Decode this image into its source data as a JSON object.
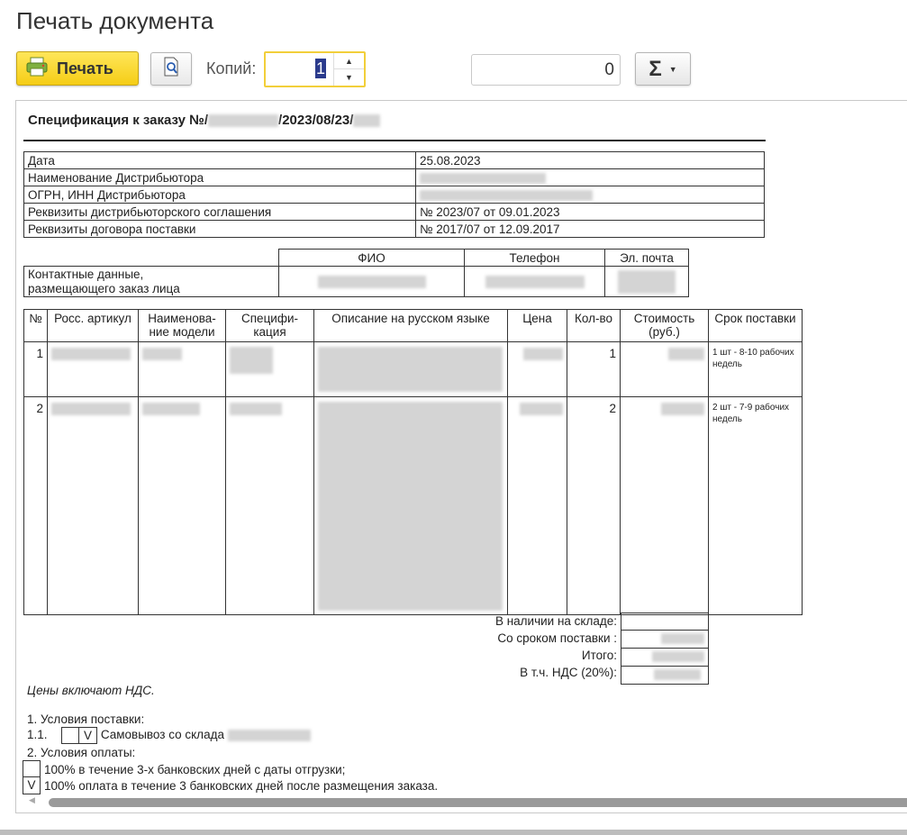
{
  "window": {
    "title": "Печать документа"
  },
  "toolbar": {
    "print_label": "Печать",
    "copies_label": "Копий:",
    "copies_value": "1",
    "sum_value": "0",
    "sum_symbol": "Σ"
  },
  "document": {
    "title_prefix": "Спецификация к заказу №/",
    "title_suffix": "/2023/08/23/",
    "info": [
      {
        "key": "Дата",
        "value": "25.08.2023"
      },
      {
        "key": "Наименование Дистрибьютора",
        "value": ""
      },
      {
        "key": "ОГРН, ИНН Дистрибьютора",
        "value": ""
      },
      {
        "key": "Реквизиты дистрибьюторского соглашения",
        "value": "№ 2023/07 от 09.01.2023"
      },
      {
        "key": "Реквизиты договора поставки",
        "value": "№ 2017/07 от 12.09.2017"
      }
    ],
    "contacts": {
      "headers": [
        "ФИО",
        "Телефон",
        "Эл. почта"
      ],
      "row_label_1": "Контактные данные,",
      "row_label_2": "размещающего заказ лица"
    },
    "items": {
      "headers": [
        "№",
        "Росс. артикул",
        "Наименова-ние модели",
        "Специфи-кация",
        "Описание на русском языке",
        "Цена",
        "Кол-во",
        "Стоимость (руб.)",
        "Срок поставки"
      ],
      "rows": [
        {
          "num": "1",
          "qty": "1",
          "delivery": "1 шт - 8-10 рабочих недель"
        },
        {
          "num": "2",
          "qty": "2",
          "delivery": "2 шт - 7-9 рабочих недель"
        }
      ]
    },
    "totals": {
      "in_stock": "В наличии на складе:",
      "with_delivery": "Со сроком поставки :",
      "total": "Итого:",
      "vat": "В т.ч. НДС (20%):"
    },
    "vat_note": "Цены включают НДС.",
    "conditions": {
      "delivery_title": "1.  Условия поставки:",
      "delivery_item_num": "1.1.",
      "delivery_item_mark": "V",
      "delivery_item_text": "Самовывоз со склада",
      "payment_title": "2.  Условия оплаты:",
      "payment_opt1_mark": "",
      "payment_opt1_text": "100% в течение 3-х банковских дней с даты отгрузки;",
      "payment_opt2_mark": "V",
      "payment_opt2_text": "100% оплата в течение 3 банковских дней после размещения заказа."
    }
  },
  "icons": {
    "print": "printer-icon",
    "preview": "magnifier-document-icon",
    "sum": "sigma-icon"
  }
}
